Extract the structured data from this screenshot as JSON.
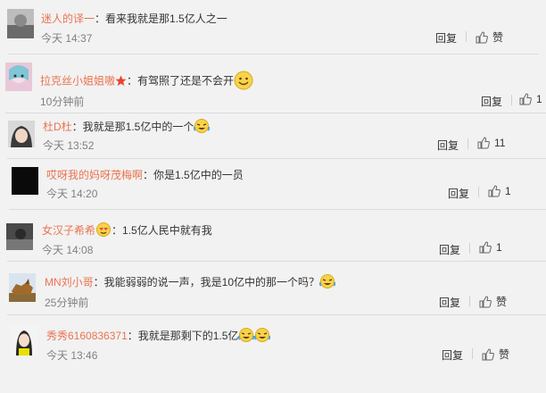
{
  "comments": [
    {
      "user": "迷人的译一",
      "text": "：看来我就是那1.5亿人之一",
      "time": "今天 14:37",
      "reply": "回复",
      "like": "赞"
    },
    {
      "user": "拉克丝小姐姐嗷",
      "text": "：有驾照了还是不会开",
      "time": "10分钟前",
      "reply": "回复",
      "like": "1"
    },
    {
      "user": "杜D杜",
      "text": "：我就是那1.5亿中的一个",
      "time": "今天 13:52",
      "reply": "回复",
      "like": "11"
    },
    {
      "user": "哎呀我的妈呀茂梅啊",
      "text": "：你是1.5亿中的一员",
      "time": "今天 14:20",
      "reply": "回复",
      "like": "1"
    },
    {
      "user": "女汉子希希",
      "text": "：1.5亿人民中就有我",
      "time": "今天 14:08",
      "reply": "回复",
      "like": "1"
    },
    {
      "user": "MN刘小哥",
      "text": "：我能弱弱的说一声，我是10亿中的那一个吗？",
      "time": "25分钟前",
      "reply": "回复",
      "like": "赞"
    },
    {
      "user": "秀秀6160836371",
      "text": "：我就是那剩下的1.5亿",
      "time": "今天 13:46",
      "reply": "回复",
      "like": "赞"
    }
  ],
  "colors": {
    "name": "#eb7350",
    "text": "#333333",
    "time": "#808080",
    "bg": "#f2f2f2"
  }
}
